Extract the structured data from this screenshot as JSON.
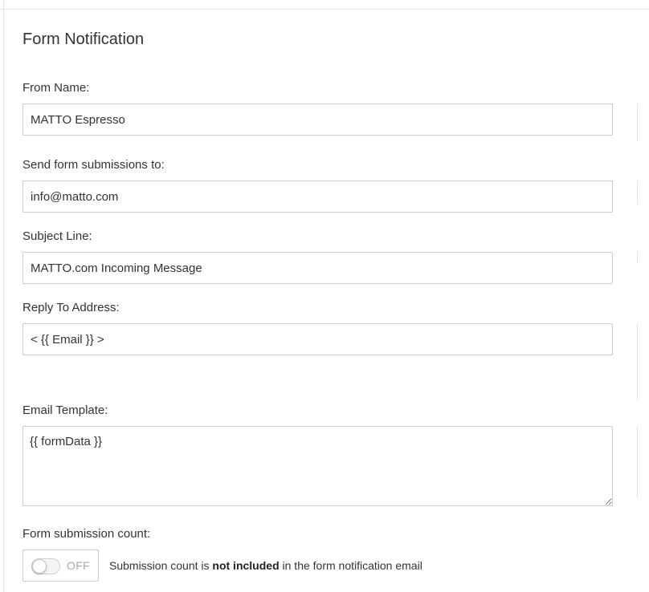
{
  "section": {
    "title": "Form Notification"
  },
  "fields": {
    "from_name": {
      "label": "From Name:",
      "value": "MATTO Espresso"
    },
    "send_to": {
      "label": "Send form submissions to:",
      "value": "info@matto.com"
    },
    "subject": {
      "label": "Subject Line:",
      "value": "MATTO.com Incoming Message"
    },
    "reply_to": {
      "label": "Reply To Address:",
      "value": "< {{ Email }} >"
    },
    "email_template": {
      "label": "Email Template:",
      "value": "{{ formData }}"
    }
  },
  "submission_count": {
    "label": "Form submission count:",
    "toggle_state": "OFF",
    "toggle_on": false,
    "description_prefix": "Submission count is ",
    "description_bold": "not included",
    "description_suffix": " in the form notification email"
  }
}
